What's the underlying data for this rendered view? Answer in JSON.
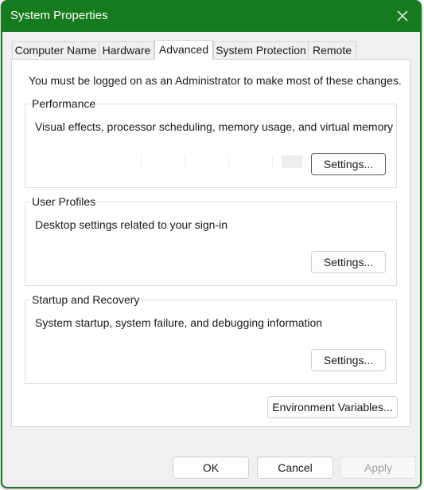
{
  "window": {
    "title": "System Properties",
    "accent_color": "#167a1f",
    "close_icon": "close-icon"
  },
  "tabs": [
    {
      "label": "Computer Name",
      "active": false
    },
    {
      "label": "Hardware",
      "active": false
    },
    {
      "label": "Advanced",
      "active": true
    },
    {
      "label": "System Protection",
      "active": false
    },
    {
      "label": "Remote",
      "active": false
    }
  ],
  "advanced": {
    "notice": "You must be logged on as an Administrator to make most of these changes.",
    "performance": {
      "label": "Performance",
      "description": "Visual effects, processor scheduling, memory usage, and virtual memory",
      "button": "Settings..."
    },
    "user_profiles": {
      "label": "User Profiles",
      "description": "Desktop settings related to your sign-in",
      "button": "Settings..."
    },
    "startup_recovery": {
      "label": "Startup and Recovery",
      "description": "System startup, system failure, and debugging information",
      "button": "Settings..."
    },
    "env_button": "Environment Variables..."
  },
  "footer": {
    "ok": "OK",
    "cancel": "Cancel",
    "apply": "Apply"
  }
}
